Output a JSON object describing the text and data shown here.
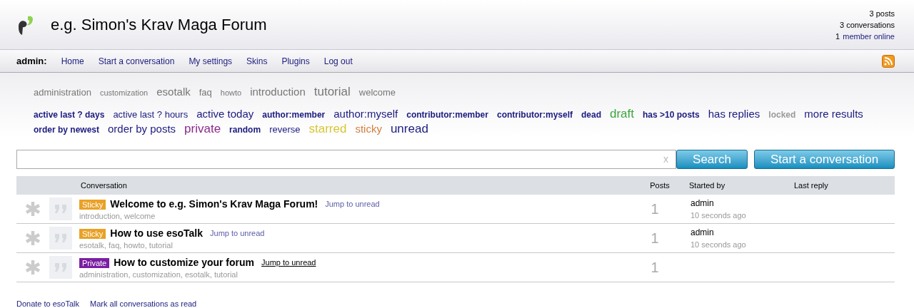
{
  "header": {
    "title": "e.g. Simon's Krav Maga Forum",
    "stats": [
      {
        "kind": "plain",
        "text": "3 posts"
      },
      {
        "kind": "plain",
        "text": "3 conversations"
      },
      {
        "kind": "link",
        "count": "1",
        "text": "member online"
      }
    ]
  },
  "nav": {
    "user": "admin:",
    "links": [
      "Home",
      "Start a conversation",
      "My settings",
      "Skins",
      "Plugins",
      "Log out"
    ]
  },
  "tags": [
    {
      "text": "administration",
      "kind": "normal"
    },
    {
      "text": "customization",
      "kind": "minor"
    },
    {
      "text": "esotalk",
      "kind": "major"
    },
    {
      "text": "faq",
      "kind": "normal"
    },
    {
      "text": "howto",
      "kind": "minor"
    },
    {
      "text": "introduction",
      "kind": "major"
    },
    {
      "text": "tutorial",
      "kind": "top"
    },
    {
      "text": "welcome",
      "kind": "normal"
    }
  ],
  "gambits": [
    {
      "text": "active last ? days",
      "kind": "minor",
      "color": "#1b1b7f"
    },
    {
      "text": "active last ? hours",
      "kind": "normal",
      "color": "#1b1b7f"
    },
    {
      "text": "active today",
      "kind": "major",
      "color": "#1b1b7f"
    },
    {
      "text": "author:member",
      "kind": "minor",
      "color": "#1b1b7f"
    },
    {
      "text": "author:myself",
      "kind": "major",
      "color": "#1b1b7f"
    },
    {
      "text": "contributor:member",
      "kind": "minor",
      "color": "#1b1b7f"
    },
    {
      "text": "contributor:myself",
      "kind": "minor",
      "color": "#1b1b7f"
    },
    {
      "text": "dead",
      "kind": "minor",
      "color": "#1b1b7f"
    },
    {
      "text": "draft",
      "kind": "top",
      "color": "#3aa63a"
    },
    {
      "text": "has >10 posts",
      "kind": "minor",
      "color": "#1b1b7f"
    },
    {
      "text": "has replies",
      "kind": "major",
      "color": "#1b1b7f"
    },
    {
      "text": "locked",
      "kind": "minor",
      "color": "#9a9a9a"
    },
    {
      "text": "more results",
      "kind": "major",
      "color": "#1b1b7f"
    },
    {
      "text": "order by newest",
      "kind": "minor",
      "color": "#1b1b7f"
    },
    {
      "text": "order by posts",
      "kind": "major",
      "color": "#1b1b7f"
    },
    {
      "text": "private",
      "kind": "top",
      "color": "#8a2a8a"
    },
    {
      "text": "random",
      "kind": "minor",
      "color": "#1b1b7f"
    },
    {
      "text": "reverse",
      "kind": "normal",
      "color": "#1b1b7f"
    },
    {
      "text": "starred",
      "kind": "top",
      "color": "#d8c533"
    },
    {
      "text": "sticky",
      "kind": "major",
      "color": "#d07f3f"
    },
    {
      "text": "unread",
      "kind": "top",
      "color": "#1b1b7f"
    }
  ],
  "search": {
    "clear": "x",
    "button": "Search"
  },
  "start_button": "Start a conversation",
  "table": {
    "columns": [
      "Conversation",
      "Posts",
      "Started by",
      "Last reply"
    ],
    "rows": [
      {
        "label": {
          "text": "Sticky",
          "color": "#e9a126"
        },
        "title": "Welcome to e.g. Simon's Krav Maga Forum!",
        "jump": "Jump to unread",
        "jump_underlined": false,
        "tags": "introduction, welcome",
        "posts": "1",
        "starter": "admin",
        "time": "10 seconds ago"
      },
      {
        "label": {
          "text": "Sticky",
          "color": "#e9a126"
        },
        "title": "How to use esoTalk",
        "jump": "Jump to unread",
        "jump_underlined": false,
        "tags": "esotalk, faq, howto, tutorial",
        "posts": "1",
        "starter": "admin",
        "time": "10 seconds ago"
      },
      {
        "label": {
          "text": "Private",
          "color": "#7b1fa2"
        },
        "title": "How to customize your forum",
        "jump": "Jump to unread",
        "jump_underlined": true,
        "tags": "administration, customization, esotalk, tutorial",
        "posts": "1"
      }
    ]
  },
  "footer": [
    "Donate to esoTalk",
    "Mark all conversations as read"
  ]
}
